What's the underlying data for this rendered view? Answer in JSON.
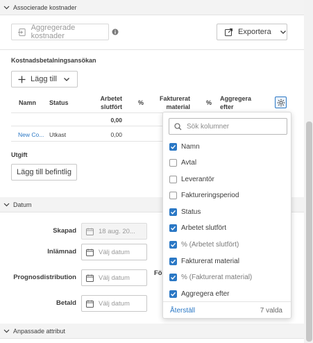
{
  "sections": {
    "associated": "Associerade kostnader",
    "dates": "Datum",
    "custom_attributes": "Anpassade attribut"
  },
  "toolbar": {
    "aggregate_label": "Aggregerade kostnader",
    "export_label": "Exportera"
  },
  "payment_application": {
    "heading": "Kostnadsbetalningsansökan",
    "add_label": "Lägg till",
    "columns": [
      "Namn",
      "Status",
      "Arbetet slutfört",
      "%",
      "Fakturerat material",
      "%",
      "Aggregera efter"
    ],
    "totals_row": {
      "arbetet_slutfort": "0,00"
    },
    "rows": [
      {
        "namn": "New Co...",
        "status": "Utkast",
        "arbetet_slutfort": "0,00"
      }
    ]
  },
  "expense": {
    "heading": "Utgift",
    "add_existing_label": "Lägg till befintlig"
  },
  "dates": {
    "created_label": "Skapad",
    "created_value": "18 aug. 20...",
    "submitted_label": "Inlämnad",
    "forecast_label": "Prognosdistribution",
    "paid_label": "Betald",
    "placeholder": "Välj datum",
    "truncated_label": "Fö"
  },
  "column_picker": {
    "search_placeholder": "Sök kolumner",
    "items": [
      {
        "label": "Namn",
        "checked": true
      },
      {
        "label": "Avtal",
        "checked": false
      },
      {
        "label": "Leverantör",
        "checked": false
      },
      {
        "label": "Faktureringsperiod",
        "checked": false
      },
      {
        "label": "Status",
        "checked": true
      },
      {
        "label": "Arbetet slutfört",
        "checked": true
      },
      {
        "label": "% (Arbetet slutfört)",
        "checked": true
      },
      {
        "label": "Fakturerat material",
        "checked": true
      },
      {
        "label": "% (Fakturerat material)",
        "checked": true
      },
      {
        "label": "Aggregera efter",
        "checked": true
      }
    ],
    "reset_label": "Återställ",
    "selected_count": "7 valda"
  },
  "colors": {
    "accent": "#2b78c5",
    "section_bg": "#f3f3f3",
    "border": "#c8c8c8"
  }
}
